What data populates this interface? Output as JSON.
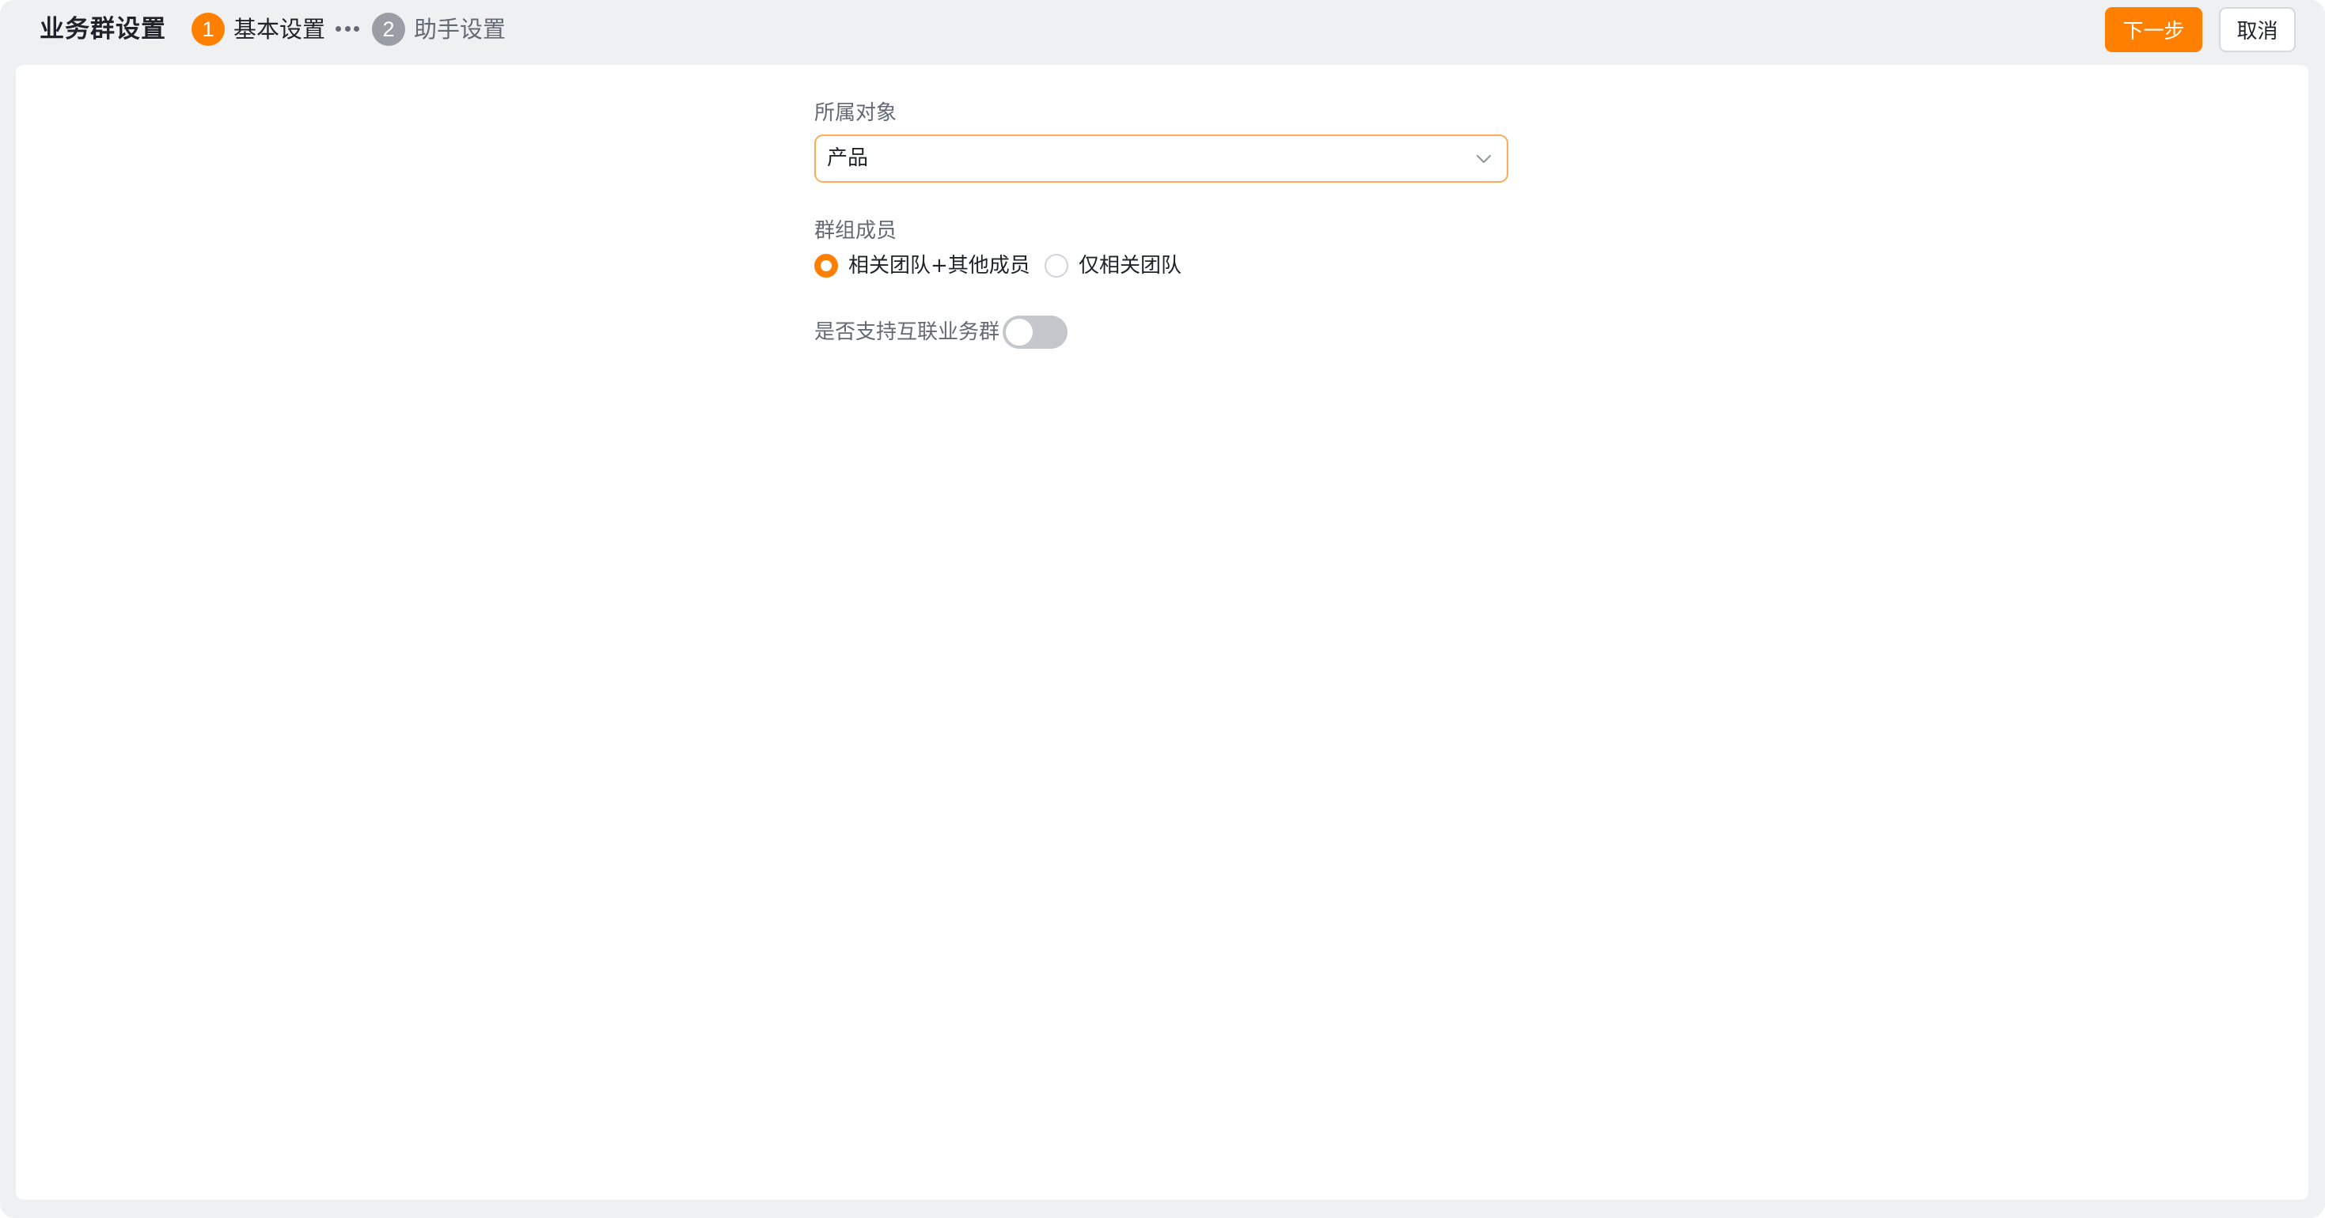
{
  "header": {
    "title": "业务群设置",
    "steps": [
      {
        "number": "1",
        "label": "基本设置",
        "status": "active"
      },
      {
        "number": "2",
        "label": "助手设置",
        "status": "inactive"
      }
    ],
    "next_label": "下一步",
    "cancel_label": "取消"
  },
  "form": {
    "object_label": "所属对象",
    "object_value": "产品",
    "members_label": "群组成员",
    "members_options": [
      {
        "label": "相关团队+其他成员",
        "checked": true
      },
      {
        "label": "仅相关团队",
        "checked": false
      }
    ],
    "interconnect_label": "是否支持互联业务群",
    "interconnect_enabled": false
  },
  "colors": {
    "accent": "#ff8000",
    "focus_border": "#ffaa55",
    "background": "#eff0f2",
    "toggle_off": "#c4c7cc"
  },
  "icons": {
    "select_arrow": "chevron-down-icon",
    "steps_separator": "more-dots-icon"
  }
}
